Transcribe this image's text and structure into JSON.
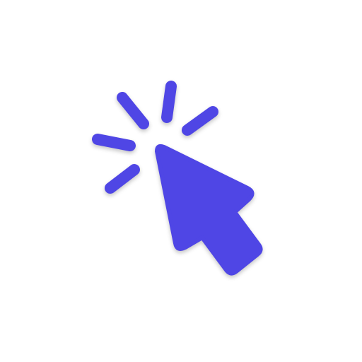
{
  "icon": {
    "name": "cursor-click-icon",
    "color": "#4f46e5",
    "background": "#ffffff"
  }
}
